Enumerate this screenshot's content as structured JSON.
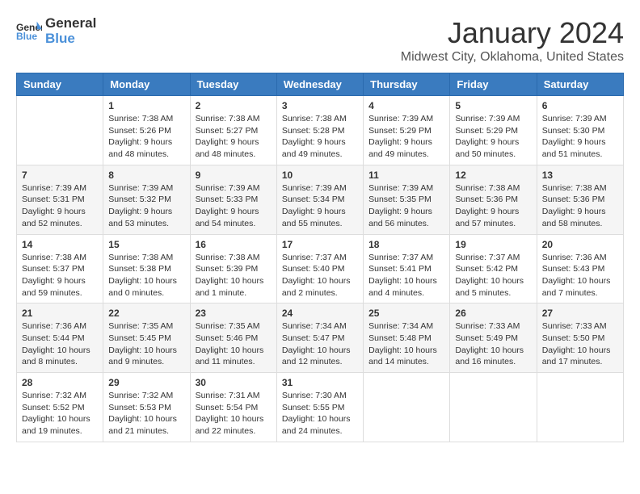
{
  "logo": {
    "line1": "General",
    "line2": "Blue"
  },
  "title": "January 2024",
  "location": "Midwest City, Oklahoma, United States",
  "days_header": [
    "Sunday",
    "Monday",
    "Tuesday",
    "Wednesday",
    "Thursday",
    "Friday",
    "Saturday"
  ],
  "weeks": [
    [
      {
        "day": "",
        "info": ""
      },
      {
        "day": "1",
        "info": "Sunrise: 7:38 AM\nSunset: 5:26 PM\nDaylight: 9 hours\nand 48 minutes."
      },
      {
        "day": "2",
        "info": "Sunrise: 7:38 AM\nSunset: 5:27 PM\nDaylight: 9 hours\nand 48 minutes."
      },
      {
        "day": "3",
        "info": "Sunrise: 7:38 AM\nSunset: 5:28 PM\nDaylight: 9 hours\nand 49 minutes."
      },
      {
        "day": "4",
        "info": "Sunrise: 7:39 AM\nSunset: 5:29 PM\nDaylight: 9 hours\nand 49 minutes."
      },
      {
        "day": "5",
        "info": "Sunrise: 7:39 AM\nSunset: 5:29 PM\nDaylight: 9 hours\nand 50 minutes."
      },
      {
        "day": "6",
        "info": "Sunrise: 7:39 AM\nSunset: 5:30 PM\nDaylight: 9 hours\nand 51 minutes."
      }
    ],
    [
      {
        "day": "7",
        "info": "Sunrise: 7:39 AM\nSunset: 5:31 PM\nDaylight: 9 hours\nand 52 minutes."
      },
      {
        "day": "8",
        "info": "Sunrise: 7:39 AM\nSunset: 5:32 PM\nDaylight: 9 hours\nand 53 minutes."
      },
      {
        "day": "9",
        "info": "Sunrise: 7:39 AM\nSunset: 5:33 PM\nDaylight: 9 hours\nand 54 minutes."
      },
      {
        "day": "10",
        "info": "Sunrise: 7:39 AM\nSunset: 5:34 PM\nDaylight: 9 hours\nand 55 minutes."
      },
      {
        "day": "11",
        "info": "Sunrise: 7:39 AM\nSunset: 5:35 PM\nDaylight: 9 hours\nand 56 minutes."
      },
      {
        "day": "12",
        "info": "Sunrise: 7:38 AM\nSunset: 5:36 PM\nDaylight: 9 hours\nand 57 minutes."
      },
      {
        "day": "13",
        "info": "Sunrise: 7:38 AM\nSunset: 5:36 PM\nDaylight: 9 hours\nand 58 minutes."
      }
    ],
    [
      {
        "day": "14",
        "info": "Sunrise: 7:38 AM\nSunset: 5:37 PM\nDaylight: 9 hours\nand 59 minutes."
      },
      {
        "day": "15",
        "info": "Sunrise: 7:38 AM\nSunset: 5:38 PM\nDaylight: 10 hours\nand 0 minutes."
      },
      {
        "day": "16",
        "info": "Sunrise: 7:38 AM\nSunset: 5:39 PM\nDaylight: 10 hours\nand 1 minute."
      },
      {
        "day": "17",
        "info": "Sunrise: 7:37 AM\nSunset: 5:40 PM\nDaylight: 10 hours\nand 2 minutes."
      },
      {
        "day": "18",
        "info": "Sunrise: 7:37 AM\nSunset: 5:41 PM\nDaylight: 10 hours\nand 4 minutes."
      },
      {
        "day": "19",
        "info": "Sunrise: 7:37 AM\nSunset: 5:42 PM\nDaylight: 10 hours\nand 5 minutes."
      },
      {
        "day": "20",
        "info": "Sunrise: 7:36 AM\nSunset: 5:43 PM\nDaylight: 10 hours\nand 7 minutes."
      }
    ],
    [
      {
        "day": "21",
        "info": "Sunrise: 7:36 AM\nSunset: 5:44 PM\nDaylight: 10 hours\nand 8 minutes."
      },
      {
        "day": "22",
        "info": "Sunrise: 7:35 AM\nSunset: 5:45 PM\nDaylight: 10 hours\nand 9 minutes."
      },
      {
        "day": "23",
        "info": "Sunrise: 7:35 AM\nSunset: 5:46 PM\nDaylight: 10 hours\nand 11 minutes."
      },
      {
        "day": "24",
        "info": "Sunrise: 7:34 AM\nSunset: 5:47 PM\nDaylight: 10 hours\nand 12 minutes."
      },
      {
        "day": "25",
        "info": "Sunrise: 7:34 AM\nSunset: 5:48 PM\nDaylight: 10 hours\nand 14 minutes."
      },
      {
        "day": "26",
        "info": "Sunrise: 7:33 AM\nSunset: 5:49 PM\nDaylight: 10 hours\nand 16 minutes."
      },
      {
        "day": "27",
        "info": "Sunrise: 7:33 AM\nSunset: 5:50 PM\nDaylight: 10 hours\nand 17 minutes."
      }
    ],
    [
      {
        "day": "28",
        "info": "Sunrise: 7:32 AM\nSunset: 5:52 PM\nDaylight: 10 hours\nand 19 minutes."
      },
      {
        "day": "29",
        "info": "Sunrise: 7:32 AM\nSunset: 5:53 PM\nDaylight: 10 hours\nand 21 minutes."
      },
      {
        "day": "30",
        "info": "Sunrise: 7:31 AM\nSunset: 5:54 PM\nDaylight: 10 hours\nand 22 minutes."
      },
      {
        "day": "31",
        "info": "Sunrise: 7:30 AM\nSunset: 5:55 PM\nDaylight: 10 hours\nand 24 minutes."
      },
      {
        "day": "",
        "info": ""
      },
      {
        "day": "",
        "info": ""
      },
      {
        "day": "",
        "info": ""
      }
    ]
  ]
}
